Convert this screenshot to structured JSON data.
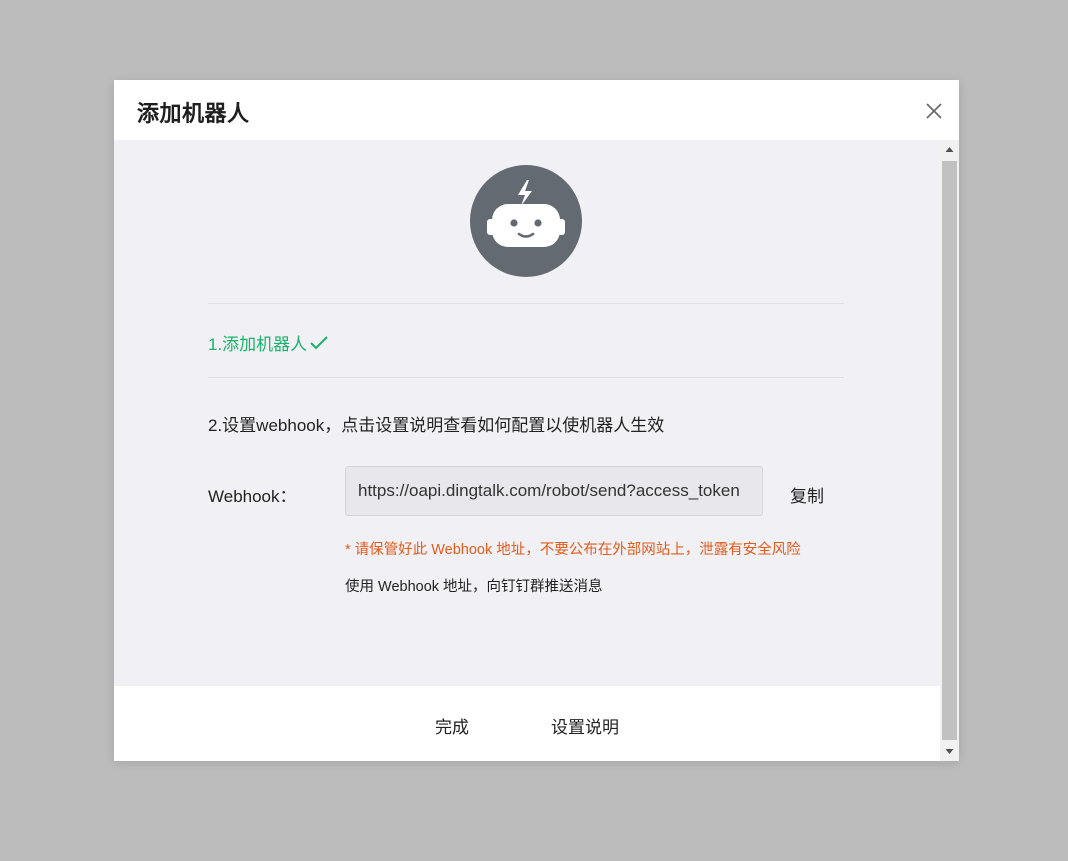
{
  "dialog": {
    "title": "添加机器人",
    "close_icon": "close-icon"
  },
  "avatar": {
    "icon": "robot-icon",
    "color": "#636a72"
  },
  "steps": {
    "step1": "1.添加机器人",
    "step1_icon": "checkmark-icon",
    "step1_color": "#19b36b",
    "step2": "2.设置webhook，点击设置说明查看如何配置以使机器人生效"
  },
  "webhook": {
    "label": "Webhook：",
    "value": "https://oapi.dingtalk.com/robot/send?access_token",
    "copy_label": "复制",
    "warning": "* 请保管好此 Webhook 地址，不要公布在外部网站上，泄露有安全风险",
    "warning_color": "#e45b1c",
    "usage": "使用 Webhook 地址，向钉钉群推送消息"
  },
  "footer": {
    "done_label": "完成",
    "help_label": "设置说明"
  }
}
